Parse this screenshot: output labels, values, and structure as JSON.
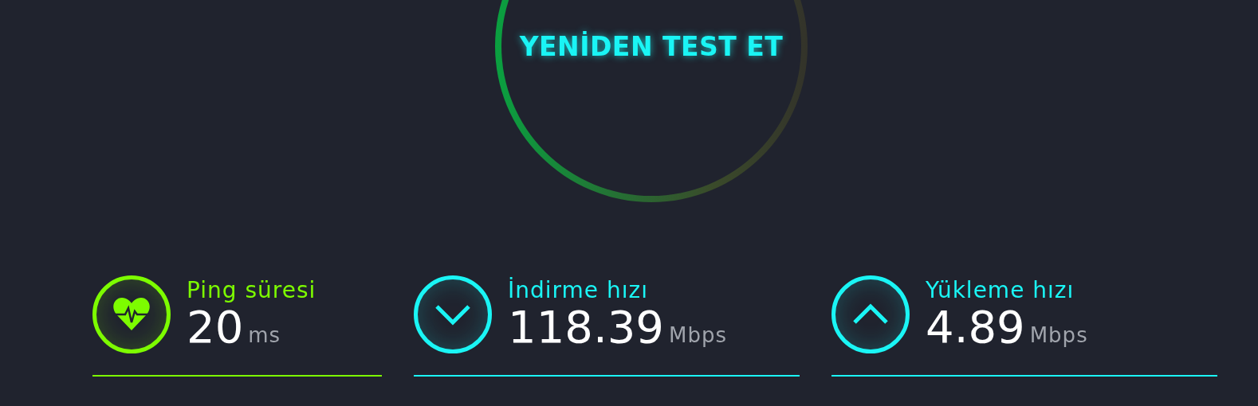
{
  "retest_button": {
    "label": "YENİDEN TEST ET"
  },
  "metrics": [
    {
      "kind": "ping",
      "label": "Ping süresi",
      "value": "20",
      "unit": "ms",
      "color": "#7dfc00"
    },
    {
      "kind": "download",
      "label": "İndirme hızı",
      "value": "118.39",
      "unit": "Mbps",
      "color": "#1af5f5"
    },
    {
      "kind": "upload",
      "label": "Yükleme hızı",
      "value": "4.89",
      "unit": "Mbps",
      "color": "#1af5f5"
    }
  ]
}
